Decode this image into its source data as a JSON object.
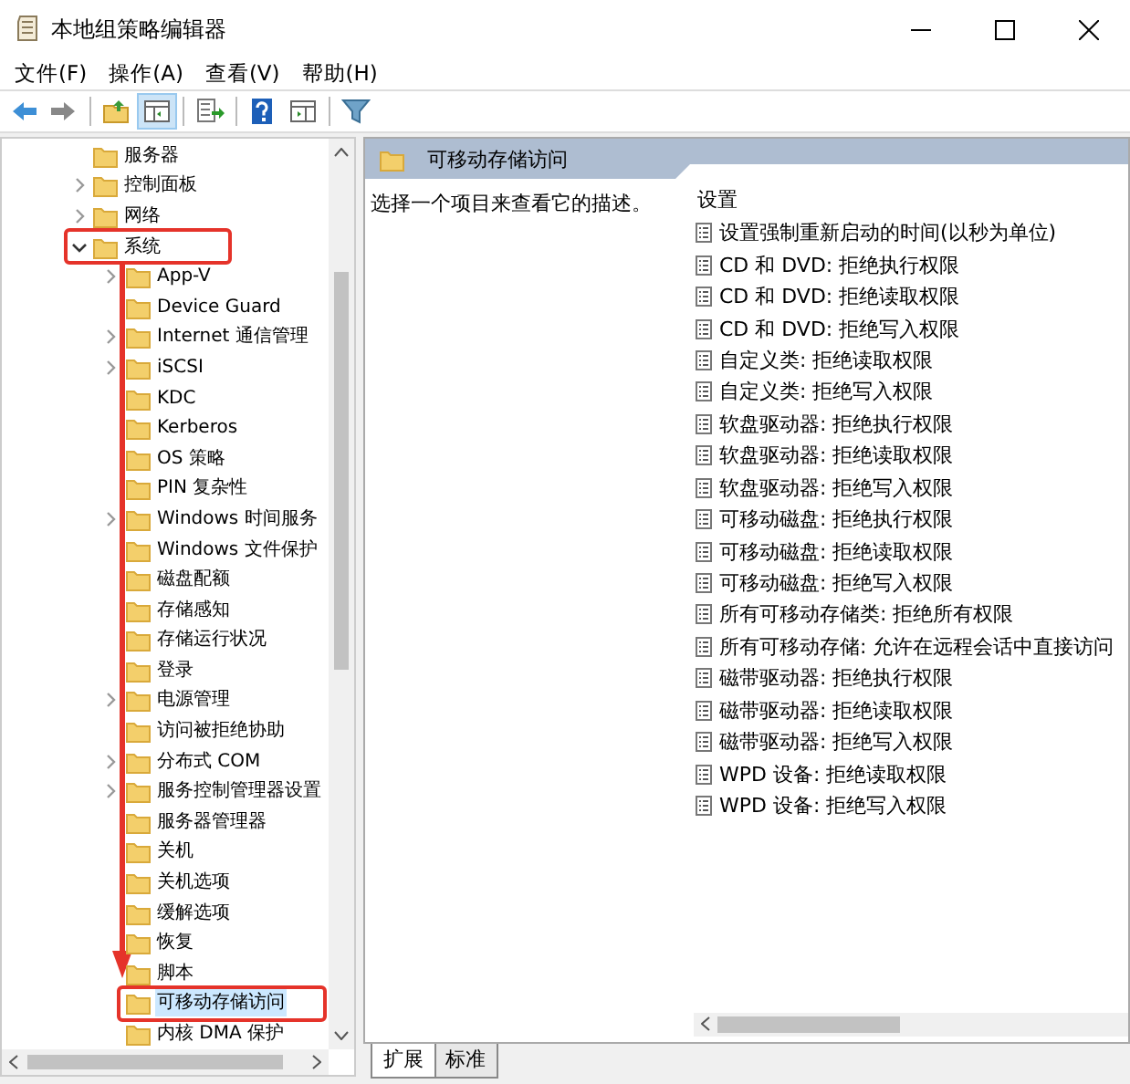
{
  "window": {
    "title": "本地组策略编辑器"
  },
  "menu": [
    "文件(F)",
    "操作(A)",
    "查看(V)",
    "帮助(H)"
  ],
  "toolbar": [
    {
      "kind": "back",
      "pressed": false
    },
    {
      "kind": "forward",
      "pressed": false
    },
    {
      "kind": "separator",
      "pressed": false
    },
    {
      "kind": "up",
      "pressed": false
    },
    {
      "kind": "console-tree",
      "pressed": true
    },
    {
      "kind": "separator",
      "pressed": false
    },
    {
      "kind": "export",
      "pressed": false
    },
    {
      "kind": "separator",
      "pressed": false
    },
    {
      "kind": "help",
      "pressed": false
    },
    {
      "kind": "action-pane",
      "pressed": false
    },
    {
      "kind": "separator",
      "pressed": false
    },
    {
      "kind": "filter",
      "pressed": false
    }
  ],
  "tree": [
    {
      "label": "服务器",
      "expandable": false,
      "expanded": false,
      "selected": false,
      "marked": false
    },
    {
      "label": "控制面板",
      "expandable": true,
      "expanded": false,
      "selected": false,
      "marked": false
    },
    {
      "label": "网络",
      "expandable": true,
      "expanded": false,
      "selected": false,
      "marked": false
    },
    {
      "label": "系统",
      "expandable": true,
      "expanded": true,
      "selected": false,
      "marked": true,
      "children": [
        {
          "label": "App-V",
          "expandable": true,
          "expanded": false,
          "selected": false,
          "marked": false
        },
        {
          "label": "Device Guard",
          "expandable": false,
          "expanded": false,
          "selected": false,
          "marked": false
        },
        {
          "label": "Internet 通信管理",
          "expandable": true,
          "expanded": false,
          "selected": false,
          "marked": false
        },
        {
          "label": "iSCSI",
          "expandable": true,
          "expanded": false,
          "selected": false,
          "marked": false
        },
        {
          "label": "KDC",
          "expandable": false,
          "expanded": false,
          "selected": false,
          "marked": false
        },
        {
          "label": "Kerberos",
          "expandable": false,
          "expanded": false,
          "selected": false,
          "marked": false
        },
        {
          "label": "OS 策略",
          "expandable": false,
          "expanded": false,
          "selected": false,
          "marked": false
        },
        {
          "label": "PIN 复杂性",
          "expandable": false,
          "expanded": false,
          "selected": false,
          "marked": false
        },
        {
          "label": "Windows 时间服务",
          "expandable": true,
          "expanded": false,
          "selected": false,
          "marked": false
        },
        {
          "label": "Windows 文件保护",
          "expandable": false,
          "expanded": false,
          "selected": false,
          "marked": false
        },
        {
          "label": "磁盘配额",
          "expandable": false,
          "expanded": false,
          "selected": false,
          "marked": false
        },
        {
          "label": "存储感知",
          "expandable": false,
          "expanded": false,
          "selected": false,
          "marked": false
        },
        {
          "label": "存储运行状况",
          "expandable": false,
          "expanded": false,
          "selected": false,
          "marked": false
        },
        {
          "label": "登录",
          "expandable": false,
          "expanded": false,
          "selected": false,
          "marked": false
        },
        {
          "label": "电源管理",
          "expandable": true,
          "expanded": false,
          "selected": false,
          "marked": false
        },
        {
          "label": "访问被拒绝协助",
          "expandable": false,
          "expanded": false,
          "selected": false,
          "marked": false
        },
        {
          "label": "分布式 COM",
          "expandable": true,
          "expanded": false,
          "selected": false,
          "marked": false
        },
        {
          "label": "服务控制管理器设置",
          "expandable": true,
          "expanded": false,
          "selected": false,
          "marked": false
        },
        {
          "label": "服务器管理器",
          "expandable": false,
          "expanded": false,
          "selected": false,
          "marked": false
        },
        {
          "label": "关机",
          "expandable": false,
          "expanded": false,
          "selected": false,
          "marked": false
        },
        {
          "label": "关机选项",
          "expandable": false,
          "expanded": false,
          "selected": false,
          "marked": false
        },
        {
          "label": "缓解选项",
          "expandable": false,
          "expanded": false,
          "selected": false,
          "marked": false
        },
        {
          "label": "恢复",
          "expandable": false,
          "expanded": false,
          "selected": false,
          "marked": false
        },
        {
          "label": "脚本",
          "expandable": false,
          "expanded": false,
          "selected": false,
          "marked": false
        },
        {
          "label": "可移动存储访问",
          "expandable": false,
          "expanded": false,
          "selected": true,
          "marked": true
        },
        {
          "label": "内核 DMA 保护",
          "expandable": false,
          "expanded": false,
          "selected": false,
          "marked": false
        }
      ]
    }
  ],
  "annotations": [
    {
      "kind": "arrow"
    }
  ],
  "detail": {
    "title": "可移动存储访问",
    "description": "选择一个项目来查看它的描述。",
    "column": "设置",
    "settings": [
      "设置强制重新启动的时间(以秒为单位)",
      "CD 和 DVD: 拒绝执行权限",
      "CD 和 DVD: 拒绝读取权限",
      "CD 和 DVD: 拒绝写入权限",
      "自定义类: 拒绝读取权限",
      "自定义类: 拒绝写入权限",
      "软盘驱动器: 拒绝执行权限",
      "软盘驱动器: 拒绝读取权限",
      "软盘驱动器: 拒绝写入权限",
      "可移动磁盘: 拒绝执行权限",
      "可移动磁盘: 拒绝读取权限",
      "可移动磁盘: 拒绝写入权限",
      "所有可移动存储类: 拒绝所有权限",
      "所有可移动存储: 允许在远程会话中直接访问",
      "磁带驱动器: 拒绝执行权限",
      "磁带驱动器: 拒绝读取权限",
      "磁带驱动器: 拒绝写入权限",
      "WPD 设备: 拒绝读取权限",
      "WPD 设备: 拒绝写入权限"
    ]
  },
  "tabs": [
    {
      "label": "扩展",
      "selected": true
    },
    {
      "label": "标准",
      "selected": false
    }
  ]
}
